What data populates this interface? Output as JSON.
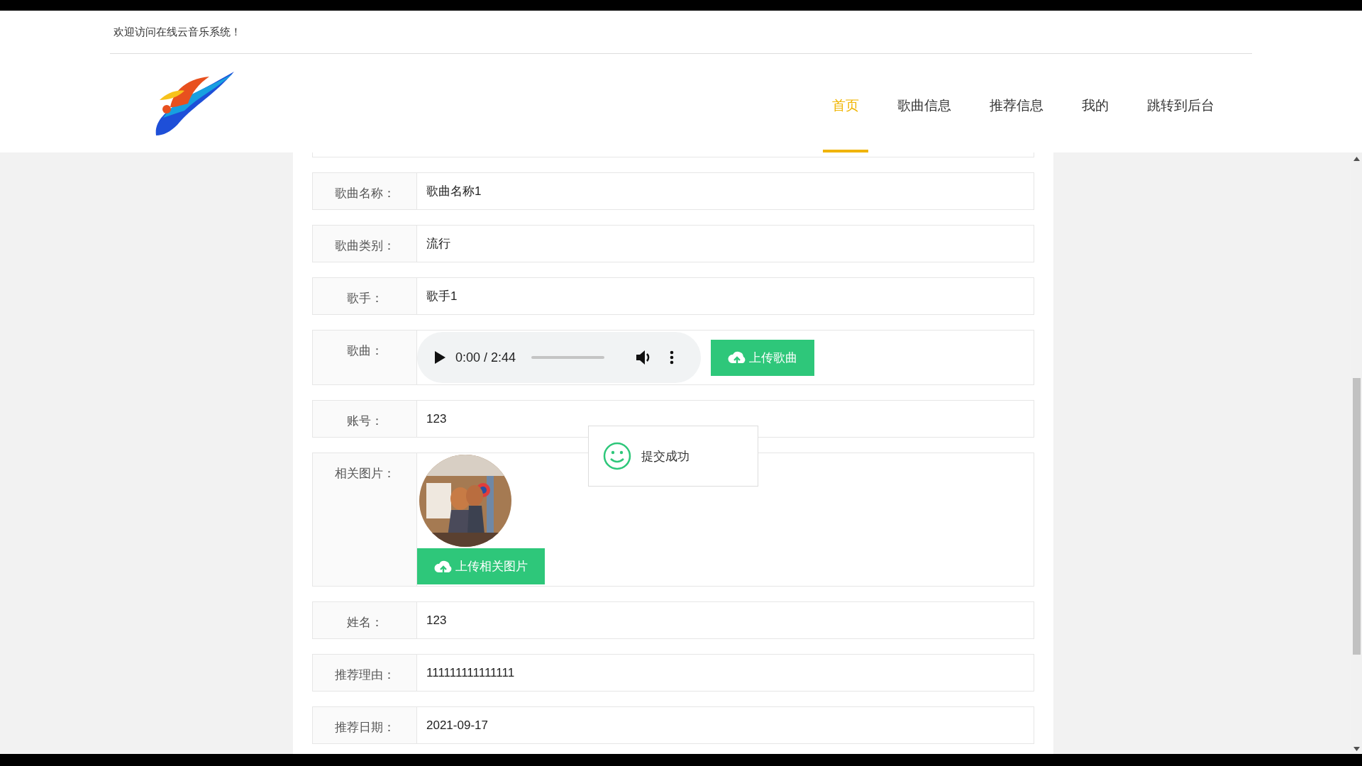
{
  "header": {
    "welcome": "欢迎访问在线云音乐系统！"
  },
  "nav": [
    {
      "label": "首页",
      "selected": true
    },
    {
      "label": "歌曲信息",
      "selected": false
    },
    {
      "label": "推荐信息",
      "selected": false
    },
    {
      "label": "我的",
      "selected": false
    },
    {
      "label": "跳转到后台",
      "selected": false
    }
  ],
  "form": {
    "rows": [
      {
        "kind": "text",
        "label": "歌曲名称：",
        "value": "歌曲名称1"
      },
      {
        "kind": "text",
        "label": "歌曲类别：",
        "value": "流行"
      },
      {
        "kind": "text",
        "label": "歌手：",
        "value": "歌手1"
      },
      {
        "kind": "audio",
        "label": "歌曲：",
        "player": {
          "time": "0:00 / 2:44",
          "level": 0
        },
        "button": "上传歌曲"
      },
      {
        "kind": "text",
        "label": "账号：",
        "value": "123"
      },
      {
        "label": "相关图片：",
        "button": "上传相关图片"
      },
      {
        "kind": "text",
        "label": "姓名：",
        "value": "123"
      },
      {
        "kind": "text",
        "label": "推荐理由：",
        "value": "111111111111111"
      },
      {
        "kind": "text",
        "label": "推荐日期：",
        "value": "2021-09-17"
      }
    ]
  },
  "toast": {
    "message": "提交成功"
  }
}
